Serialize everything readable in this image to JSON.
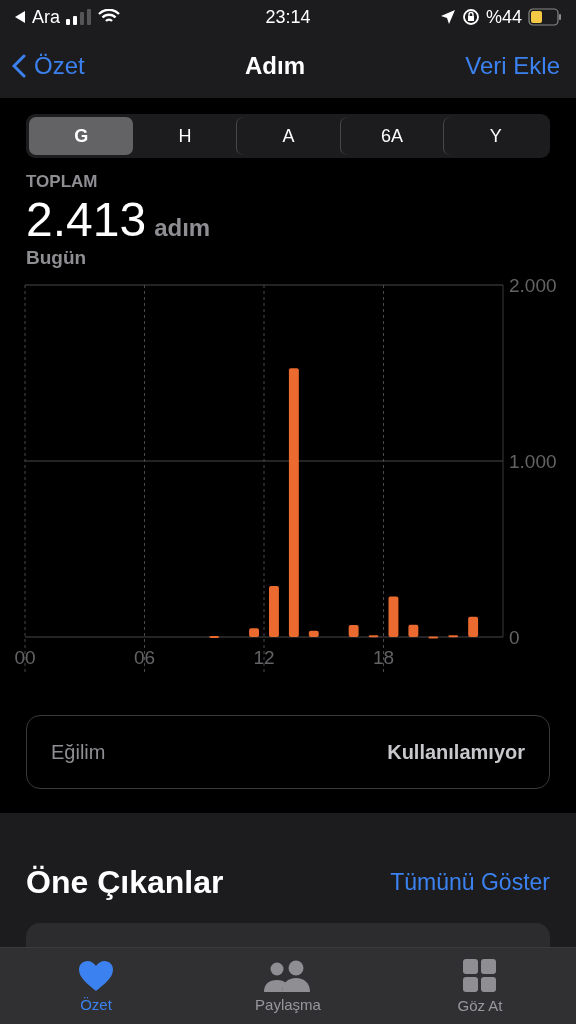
{
  "status_bar": {
    "back_label": "Ara",
    "time": "23:14",
    "battery": "%44"
  },
  "nav": {
    "back": "Özet",
    "title": "Adım",
    "action": "Veri Ekle"
  },
  "segments": [
    {
      "label": "G",
      "selected": true
    },
    {
      "label": "H",
      "selected": false
    },
    {
      "label": "A",
      "selected": false
    },
    {
      "label": "6A",
      "selected": false
    },
    {
      "label": "Y",
      "selected": false
    }
  ],
  "summary": {
    "label": "TOPLAM",
    "value": "2.413",
    "unit": "adım",
    "period": "Bugün"
  },
  "chart_data": {
    "type": "bar",
    "x": [
      9.5,
      11.5,
      12.5,
      13.5,
      14.5,
      16.5,
      17.5,
      18.5,
      19.5,
      20.5,
      21.5,
      22.5
    ],
    "xlim": [
      0,
      24
    ],
    "grid": true,
    "ref_lines": [
      {
        "axis": "y",
        "value": 1000
      }
    ],
    "series": [
      {
        "color": "#eb6a2f",
        "values": [
          5,
          50,
          290,
          1527,
          35,
          68,
          10,
          230,
          70,
          3,
          10,
          115
        ]
      }
    ],
    "ylim": [
      0,
      2000
    ],
    "xticks": [
      {
        "value": 0,
        "label": "00"
      },
      {
        "value": 6,
        "label": "06"
      },
      {
        "value": 12,
        "label": "12"
      },
      {
        "value": 18,
        "label": "18"
      }
    ],
    "yticks": [
      {
        "value": 0,
        "label": "0"
      },
      {
        "value": 1000,
        "label": "1.000"
      },
      {
        "value": 2000,
        "label": "2.000"
      }
    ]
  },
  "trend": {
    "label": "Eğilim",
    "value": "Kullanılamıyor"
  },
  "highlights": {
    "title": "Öne Çıkanlar",
    "link": "Tümünü Göster"
  },
  "tabs": [
    {
      "label": "Özet",
      "selected": true
    },
    {
      "label": "Paylaşma",
      "selected": false
    },
    {
      "label": "Göz At",
      "selected": false
    }
  ]
}
